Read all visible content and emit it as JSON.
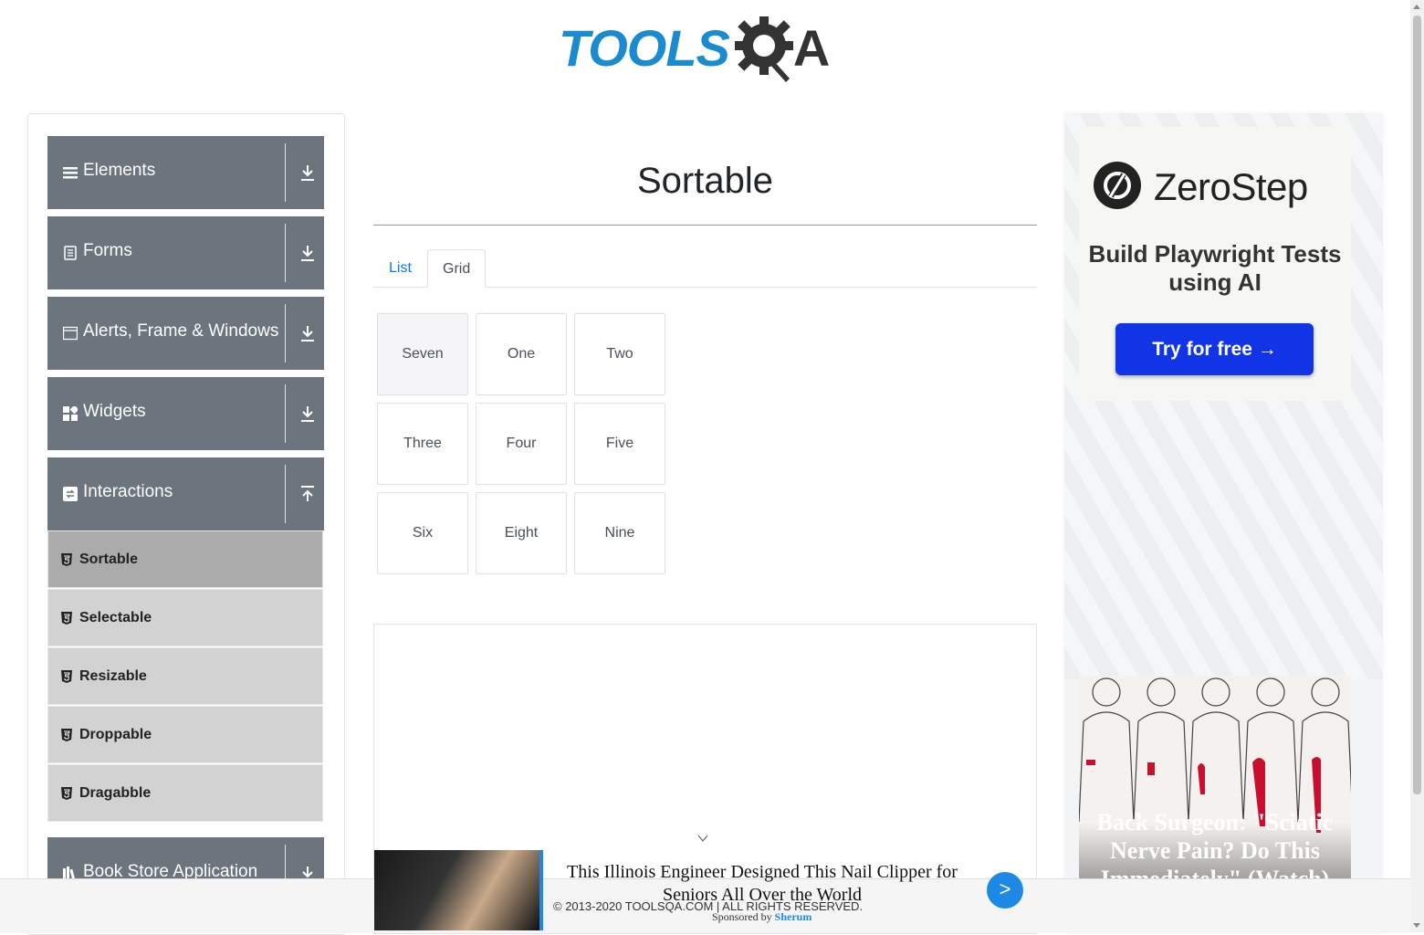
{
  "header": {
    "logo_left": "TOOLS",
    "logo_right": "A"
  },
  "sidebar": {
    "groups": [
      {
        "label": "Elements"
      },
      {
        "label": "Forms"
      },
      {
        "label": "Alerts, Frame & Windows"
      },
      {
        "label": "Widgets"
      },
      {
        "label": "Interactions"
      },
      {
        "label": "Book Store Application"
      }
    ],
    "interactions_items": [
      {
        "label": "Sortable"
      },
      {
        "label": "Selectable"
      },
      {
        "label": "Resizable"
      },
      {
        "label": "Droppable"
      },
      {
        "label": "Dragabble"
      }
    ]
  },
  "main": {
    "title": "Sortable",
    "tabs": [
      {
        "label": "List"
      },
      {
        "label": "Grid"
      }
    ],
    "active_tab": "Grid",
    "grid_items": [
      "Seven",
      "One",
      "Two",
      "Three",
      "Four",
      "Five",
      "Six",
      "Eight",
      "Nine"
    ]
  },
  "right_ads": {
    "zerostep": {
      "brand": "ZeroStep",
      "tagline": "Build Playwright Tests using AI",
      "cta": "Try for free →"
    },
    "surgeon": {
      "text": "Back Surgeon: \"Sciatic Nerve Pain? Do This Immediately\" (Watch)"
    }
  },
  "bottom_ad": {
    "headline": "This Illinois Engineer Designed This Nail Clipper for Seniors All Over the World",
    "sponsored_prefix": "Sponsored by",
    "sponsor": "Sherum",
    "button": ">"
  },
  "footer": {
    "copyright": "© 2013-2020 TOOLSQA.COM | ALL RIGHTS RESERVED."
  },
  "colors": {
    "sidebar_group": "#6c757d",
    "sub_item": "#d2d2d2",
    "sub_active": "#ababab",
    "link": "#007bff",
    "brand_blue": "#1b8bcf",
    "cta_blue": "#1034e6"
  }
}
